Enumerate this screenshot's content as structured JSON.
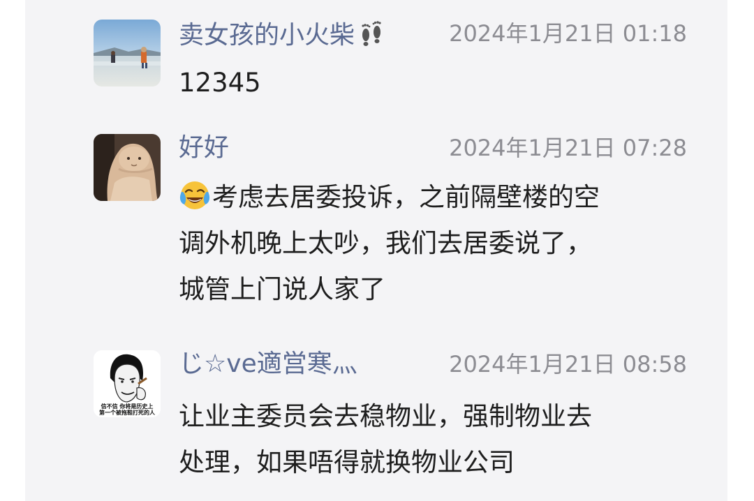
{
  "comments": [
    {
      "username": "卖女孩的小火柴",
      "username_icon": "footprints-icon",
      "timestamp": "2024年1月21日 01:18",
      "lines": [
        "12345"
      ],
      "avatar": "beach-photo"
    },
    {
      "username": "好好",
      "timestamp": "2024年1月21日 07:28",
      "emoji": "tears-of-joy-emoji-icon",
      "lines": [
        "考虑去居委投诉，之前隔壁楼的空",
        "调外机晚上太吵，我们去居委说了，",
        "城管上门说人家了"
      ],
      "avatar": "plush-toy-photo"
    },
    {
      "username": "じ☆ve適営寒灬",
      "timestamp": "2024年1月21日 08:58",
      "lines": [
        "让业主委员会去稳物业，强制物业去",
        "处理，如果唔得就换物业公司"
      ],
      "avatar": "meme-face",
      "avatar_caption": [
        "信不信 你将是历史上",
        "第一个被拖鞋打死的人"
      ]
    }
  ],
  "colors": {
    "username": "#5a6a92",
    "timestamp": "#8c8c92",
    "text": "#1e1e1e",
    "background": "#f4f4f6"
  }
}
